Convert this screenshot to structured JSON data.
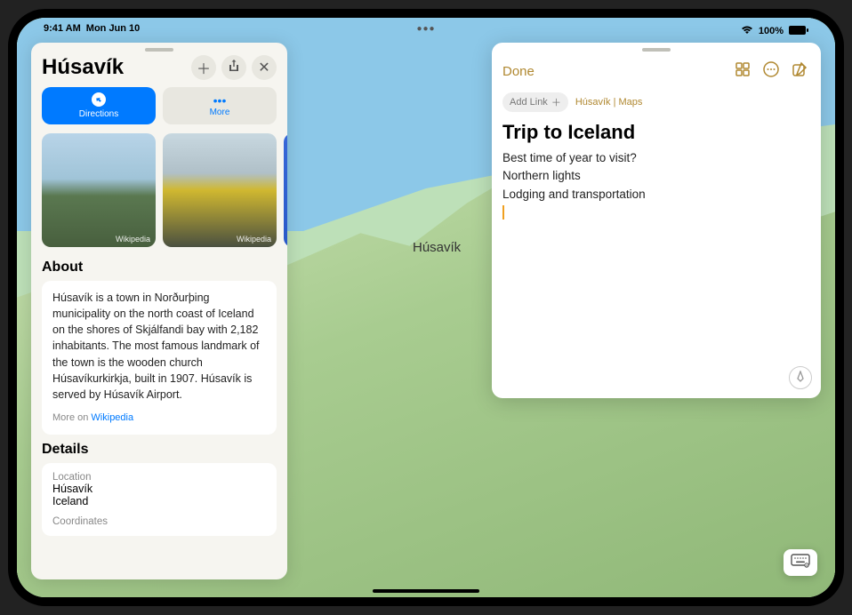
{
  "status": {
    "time": "9:41 AM",
    "date": "Mon Jun 10",
    "battery_pct": "100%"
  },
  "map": {
    "label": "Húsavík"
  },
  "place_card": {
    "title": "Húsavík",
    "directions_label": "Directions",
    "more_label": "More",
    "photo_credit": "Wikipedia",
    "about": {
      "heading": "About",
      "text": "Húsavík is a town in Norðurþing municipality on the north coast of Iceland on the shores of Skjálfandi bay with 2,182 inhabitants. The most famous landmark of the town is the wooden church Húsavíkurkirkja, built in 1907. Húsavík is served by Húsavík Airport.",
      "more_prefix": "More on ",
      "more_link": "Wikipedia"
    },
    "details": {
      "heading": "Details",
      "location_label": "Location",
      "location_line1": "Húsavík",
      "location_line2": "Iceland",
      "coordinates_label": "Coordinates"
    }
  },
  "notes": {
    "done": "Done",
    "add_link": "Add Link",
    "linked": "Húsavík | Maps",
    "title": "Trip to Iceland",
    "lines": [
      "Best time of year to visit?",
      "Northern lights",
      "Lodging and transportation"
    ]
  }
}
